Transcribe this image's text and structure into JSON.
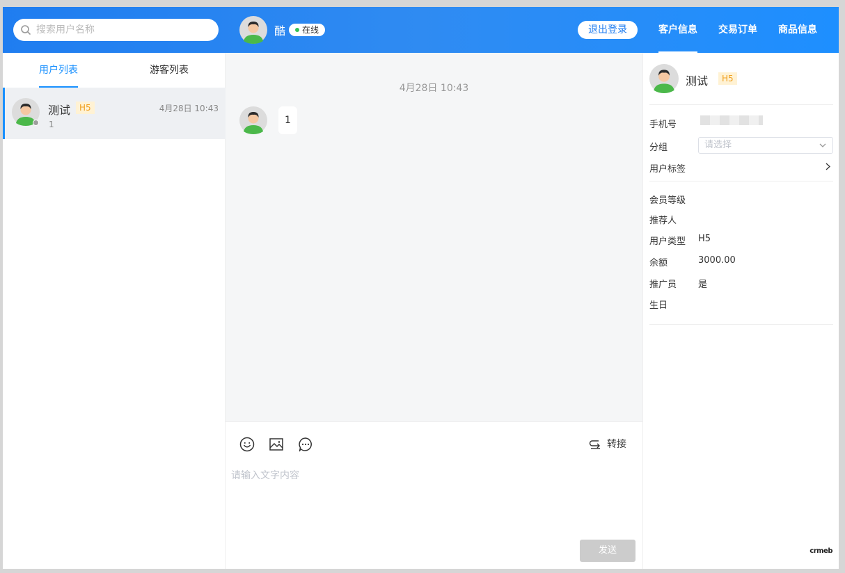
{
  "header": {
    "search_placeholder": "搜索用户名称",
    "agent_name": "酷",
    "agent_status": "在线",
    "logout_label": "退出登录",
    "nav": [
      "客户信息",
      "交易订单",
      "商品信息"
    ]
  },
  "sidebar": {
    "tabs": [
      "用户列表",
      "游客列表"
    ],
    "users": [
      {
        "name": "测试",
        "tag": "H5",
        "time": "4月28日 10:43",
        "last_message": "1"
      }
    ]
  },
  "chat": {
    "timestamp": "4月28日 10:43",
    "messages": [
      {
        "text": "1"
      }
    ],
    "toolbar": {
      "transfer_label": "转接"
    },
    "input_placeholder": "请输入文字内容",
    "send_label": "发送"
  },
  "customer": {
    "name": "测试",
    "tag": "H5",
    "fields": {
      "phone_label": "手机号",
      "group_label": "分组",
      "group_placeholder": "请选择",
      "tags_label": "用户标签",
      "level_label": "会员等级",
      "referrer_label": "推荐人",
      "type_label": "用户类型",
      "type_value": "H5",
      "balance_label": "余额",
      "balance_value": "3000.00",
      "promoter_label": "推广员",
      "promoter_value": "是",
      "birthday_label": "生日"
    }
  },
  "brand": "crmeb",
  "colors": {
    "header_blue": "#1f7df0",
    "accent": "#1890ff",
    "online_green": "#35c257",
    "tag_bg": "#fff2d4",
    "tag_text": "#f0a020"
  }
}
